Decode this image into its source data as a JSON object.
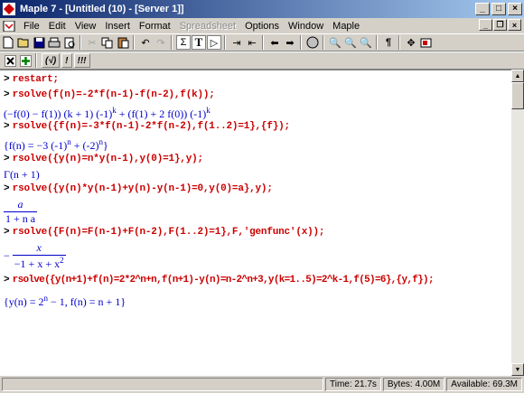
{
  "window": {
    "title": "Maple 7 - [Untitled (10) - [Server 1]]"
  },
  "menu": {
    "items": [
      "File",
      "Edit",
      "View",
      "Insert",
      "Format",
      "Spreadsheet",
      "Options",
      "Window",
      "Maple"
    ]
  },
  "toolbar": {
    "sigma": "Σ",
    "text_T": "T",
    "paragraph": "¶",
    "sqrt_label": "(√)",
    "excl_label": "!",
    "triple_excl_label": "!!!"
  },
  "worksheet": {
    "prompt": ">",
    "lines": [
      {
        "cmd": "restart;"
      },
      {
        "cmd": "rsolve(f(n)=-2*f(n-1)-f(n-2),f(k));"
      },
      {
        "out_a": "(−f(0) − f(1)) (k + 1) (-1)",
        "out_a_sup": "k",
        "out_b": " + (f(1) + 2 f(0)) (-1)",
        "out_b_sup": "k"
      },
      {
        "cmd": "rsolve({f(n)=-3*f(n-1)-2*f(n-2),f(1..2)=1},{f});"
      },
      {
        "out_a": "{f(n) = −3 (-1)",
        "out_a_sup": "n",
        "out_b": " + (-2)",
        "out_b_sup": "n",
        "out_c": "}"
      },
      {
        "cmd": "rsolve({y(n)=n*y(n-1),y(0)=1},y);"
      },
      {
        "out": "Γ(n + 1)"
      },
      {
        "cmd": "rsolve({y(n)*y(n-1)+y(n)-y(n-1)=0,y(0)=a},y);"
      },
      {
        "num": "a",
        "den": "1 + n a"
      },
      {
        "cmd": "rsolve({F(n)=F(n-1)+F(n-2),F(1..2)=1},F,'genfunc'(x));"
      },
      {
        "sign": "−",
        "num": "x",
        "den_a": "−1 + x + x",
        "den_sup": "2"
      },
      {
        "cmd": "rsolve({y(n+1)+f(n)=2*2^n+n,f(n+1)-y(n)=n-2^n+3,y(k=1..5)=2^k-1,f(5)=6},{y,f});"
      },
      {
        "out_a": "{y(n) = 2",
        "out_a_sup": "n",
        "out_b": " − 1, f(n) = n + 1}"
      }
    ]
  },
  "status": {
    "time": "Time: 21.7s",
    "bytes": "Bytes: 4.00M",
    "available": "Available: 69.3M"
  }
}
